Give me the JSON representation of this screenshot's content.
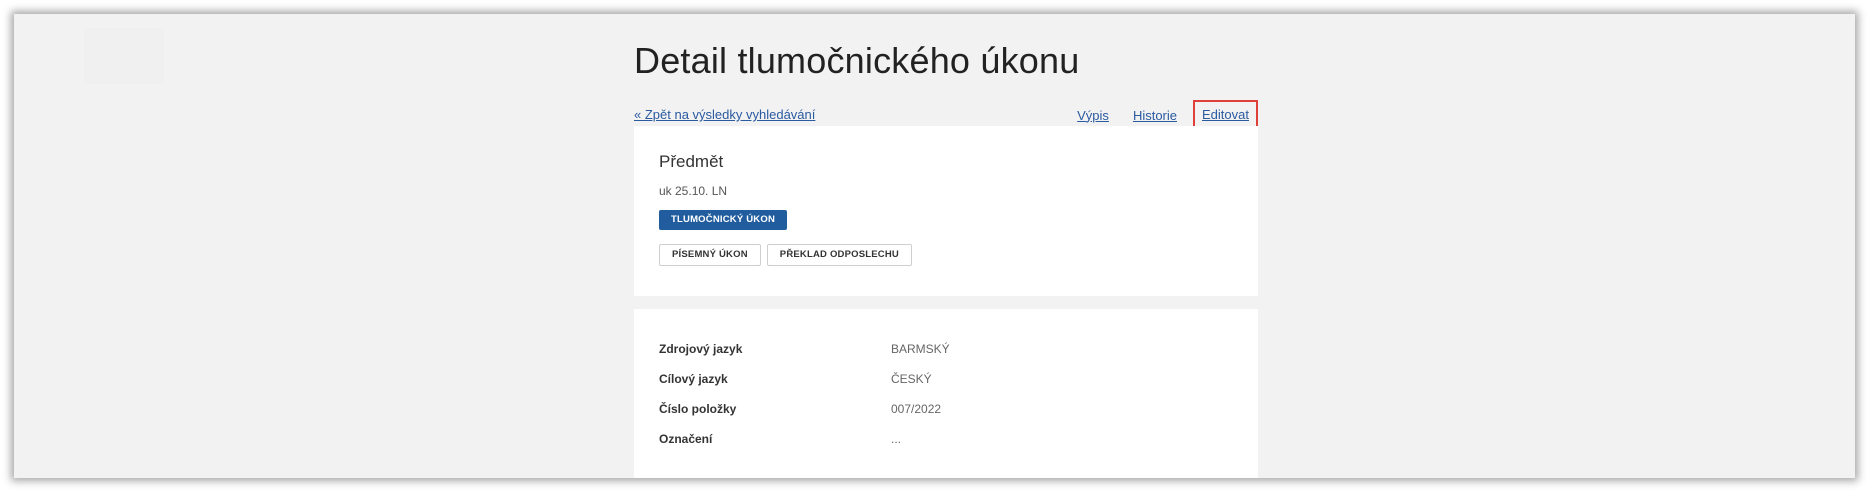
{
  "page": {
    "title": "Detail tlumočnického úkonu"
  },
  "nav": {
    "back": "« Zpět na výsledky vyhledávání",
    "vypis": "Výpis",
    "historie": "Historie",
    "editovat": "Editovat"
  },
  "subject": {
    "heading": "Předmět",
    "text": "uk 25.10. LN",
    "primary_badge": "TLUMOČNICKÝ ÚKON",
    "tags": [
      "PÍSEMNÝ ÚKON",
      "PŘEKLAD ODPOSLECHU"
    ]
  },
  "details": [
    {
      "label": "Zdrojový jazyk",
      "value": "BARMSKÝ"
    },
    {
      "label": "Cílový jazyk",
      "value": "ČESKÝ"
    },
    {
      "label": "Číslo položky",
      "value": "007/2022"
    },
    {
      "label": "Označení",
      "value": "..."
    }
  ],
  "colors": {
    "link": "#2a5aa0",
    "primary_badge_bg": "#215d9e",
    "highlight_border": "#e0403a"
  }
}
